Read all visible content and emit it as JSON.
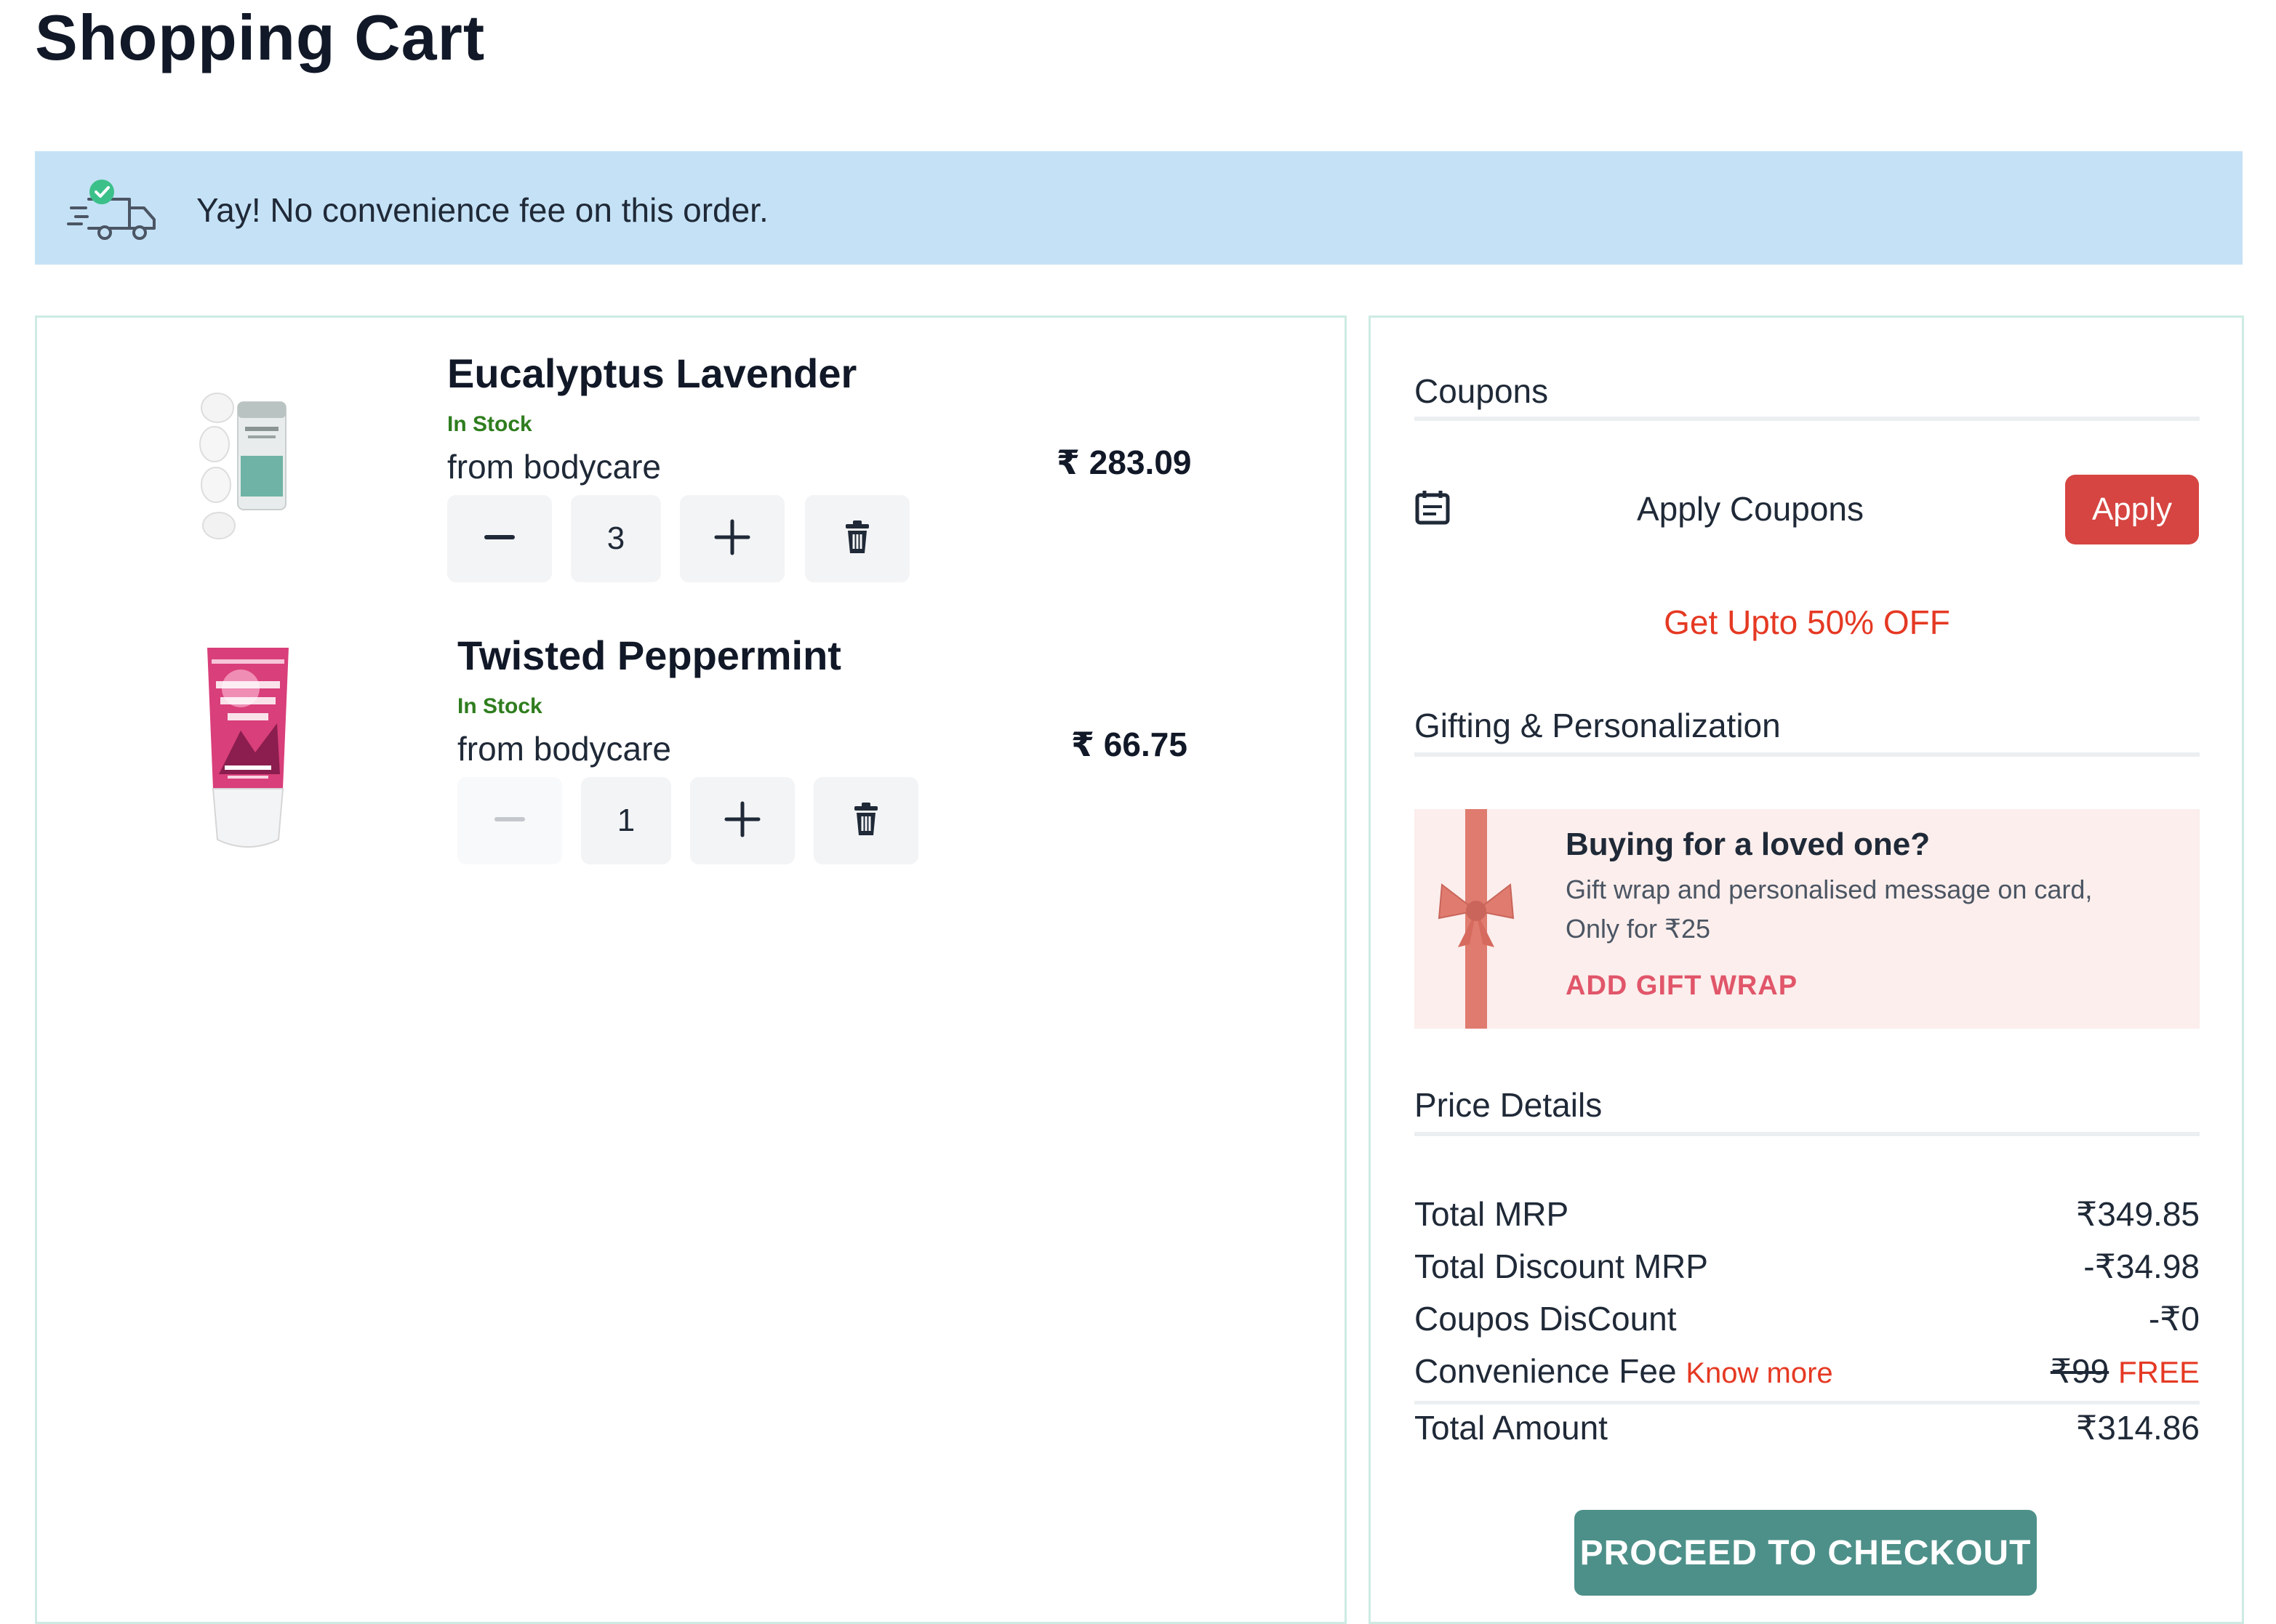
{
  "page": {
    "title": "Shopping Cart"
  },
  "banner": {
    "icon": "delivery-truck-check-icon",
    "text": "Yay! No convenience fee on this order."
  },
  "cart": {
    "items": [
      {
        "name": "Eucalyptus Lavender",
        "stock": "In Stock",
        "from": "from bodycare",
        "price": "₹ 283.09",
        "quantity": "3",
        "image": "bath-fizzies-product-image"
      },
      {
        "name": "Twisted Peppermint",
        "stock": "In Stock",
        "from": "from bodycare",
        "price": "₹ 66.75",
        "quantity": "1",
        "image": "body-cream-tube-product-image"
      }
    ]
  },
  "coupons": {
    "title": "Coupons",
    "icon": "coupon-calendar-icon",
    "apply_label": "Apply Coupons",
    "apply_button": "Apply",
    "offer": "Get Upto 50% OFF"
  },
  "gifting": {
    "title": "Gifting & Personalization",
    "heading": "Buying for a loved one?",
    "desc_line1": "Gift wrap and personalised message on card,",
    "desc_line2": "Only for ₹25",
    "cta": "ADD GIFT WRAP"
  },
  "price": {
    "title": "Price Details",
    "rows": [
      {
        "label": "Total MRP",
        "value": "₹349.85"
      },
      {
        "label": "Total Discount MRP",
        "value": "-₹34.98"
      },
      {
        "label": "Coupos DisCount",
        "value": "-₹0"
      }
    ],
    "fee": {
      "label": "Convenience Fee",
      "link": "Know more",
      "old": "₹99",
      "new": "FREE"
    },
    "total": {
      "label": "Total Amount",
      "value": "₹314.86"
    }
  },
  "checkout": {
    "label": "PROCEED TO CHECKOUT"
  },
  "colors": {
    "banner": "#c5e1f6",
    "apply": "#d64541",
    "offer": "#e53923",
    "checkout": "#4d9089",
    "stock": "#2f7d1e",
    "gift_bg": "#fbeeec",
    "gift_link": "#e1566a",
    "panel_border": "#cdebe3"
  }
}
